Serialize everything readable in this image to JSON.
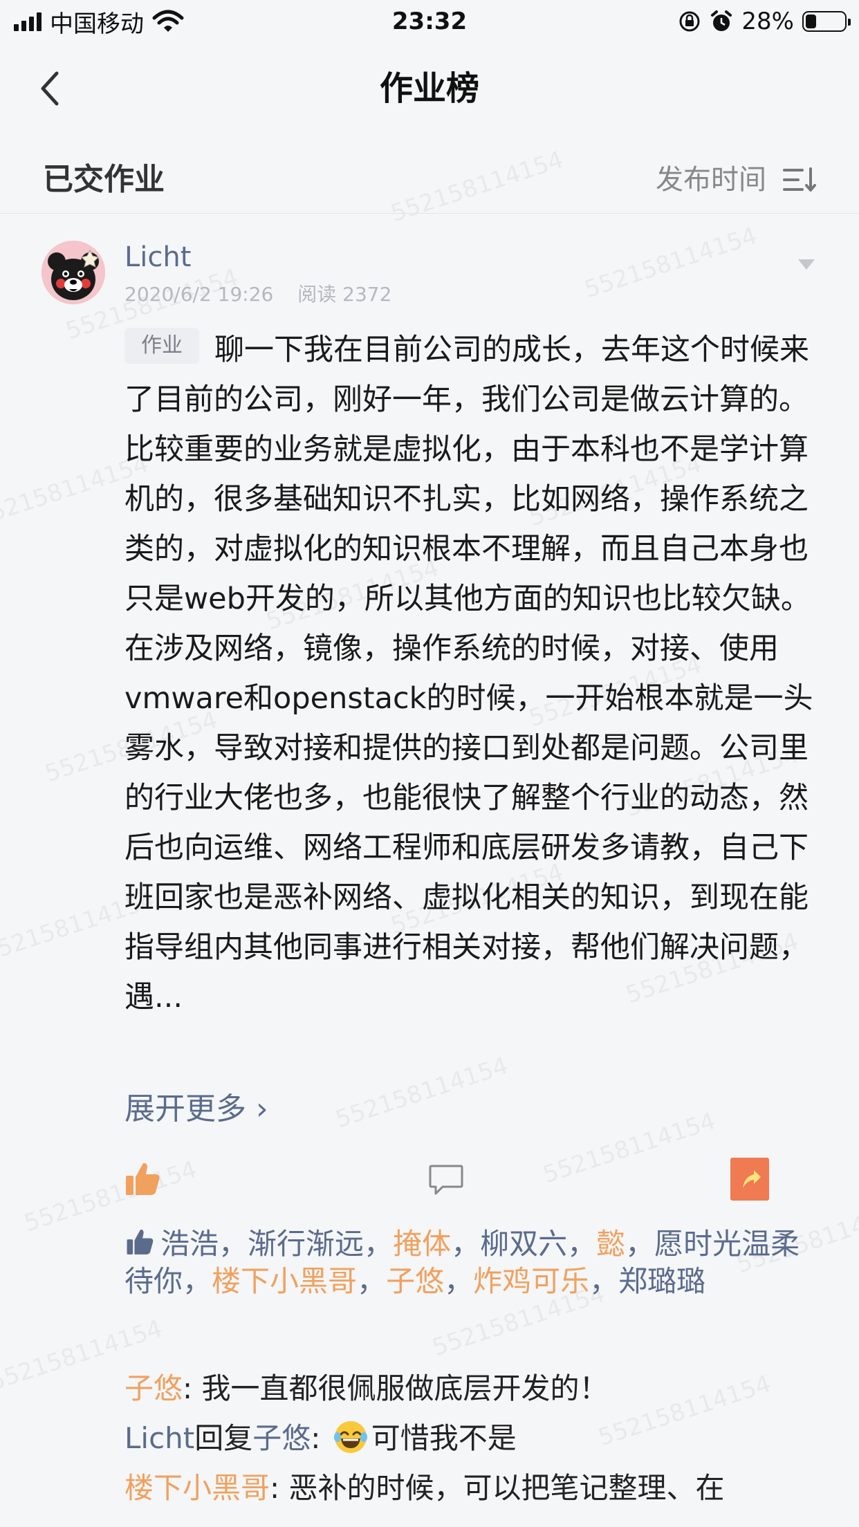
{
  "status_bar": {
    "carrier": "中国移动",
    "time": "23:32",
    "battery_percent": "28%",
    "battery_level": 0.28
  },
  "nav": {
    "title": "作业榜"
  },
  "subheader": {
    "title": "已交作业",
    "sort_label": "发布时间"
  },
  "watermark": "552158114154",
  "post": {
    "author": "Licht",
    "date": "2020/6/2 19:26",
    "reads": "阅读 2372",
    "tag": "作业",
    "body": "聊一下我在目前公司的成长，去年这个时候来了目前的公司，刚好一年，我们公司是做云计算的。比较重要的业务就是虚拟化，由于本科也不是学计算机的，很多基础知识不扎实，比如网络，操作系统之类的，对虚拟化的知识根本不理解，而且自己本身也只是web开发的，所以其他方面的知识也比较欠缺。在涉及网络，镜像，操作系统的时候，对接、使用vmware和openstack的时候，一开始根本就是一头雾水，导致对接和提供的接口到处都是问题。公司里的行业大佬也多，也能很快了解整个行业的动态，然后也向运维、网络工程师和底层研发多请教，自己下班回家也是恶补网络、虚拟化相关的知识，到现在能指导组内其他同事进行相关对接，帮他们解决问题，遇...",
    "expand_label": "展开更多 ›",
    "likers": [
      {
        "name": "浩浩",
        "color": "blue"
      },
      {
        "name": "渐行渐远",
        "color": "blue"
      },
      {
        "name": "掩体",
        "color": "orange"
      },
      {
        "name": "柳双六",
        "color": "blue"
      },
      {
        "name": "懿",
        "color": "orange"
      },
      {
        "name": "愿时光温柔待你",
        "color": "blue"
      },
      {
        "name": "楼下小黑哥",
        "color": "orange"
      },
      {
        "name": "子悠",
        "color": "orange"
      },
      {
        "name": "炸鸡可乐",
        "color": "orange"
      },
      {
        "name": "郑璐璐",
        "color": "blue"
      }
    ],
    "comments": [
      {
        "author": "子悠",
        "reply_word": "",
        "reply_to": "",
        "text": ": 我一直都很佩服做底层开发的！"
      },
      {
        "author": "Licht",
        "reply_word": "回复",
        "reply_to": "子悠",
        "text": "可惜我不是"
      },
      {
        "author": "楼下小黑哥",
        "reply_word": "",
        "reply_to": "",
        "text": ": 恶补的时候，可以把笔记整理、在"
      }
    ]
  }
}
